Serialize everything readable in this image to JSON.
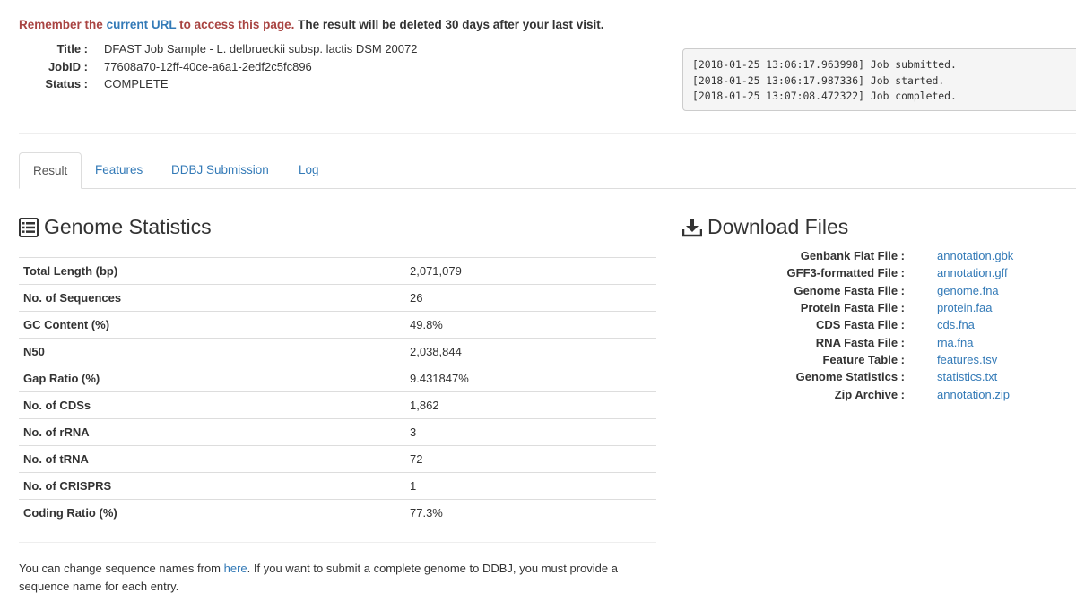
{
  "notice": {
    "prefix": "Remember the",
    "link": "current URL",
    "mid": "to access this page.",
    "rest": "The result will be deleted 30 days after your last visit."
  },
  "job": {
    "title_label": "Title :",
    "title": "DFAST Job Sample - L. delbrueckii subsp. lactis DSM 20072",
    "jobid_label": "JobID :",
    "jobid": "77608a70-12ff-40ce-a6a1-2edf2c5fc896",
    "status_label": "Status :",
    "status": "COMPLETE"
  },
  "log": [
    "[2018-01-25 13:06:17.963998] Job submitted.",
    "[2018-01-25 13:06:17.987336] Job started.",
    "[2018-01-25 13:07:08.472322] Job completed."
  ],
  "tabs": [
    "Result",
    "Features",
    "DDBJ Submission",
    "Log"
  ],
  "stats": {
    "heading": "Genome Statistics",
    "rows": [
      {
        "key": "Total Length (bp)",
        "value": "2,071,079"
      },
      {
        "key": "No. of Sequences",
        "value": "26"
      },
      {
        "key": "GC Content (%)",
        "value": "49.8%"
      },
      {
        "key": "N50",
        "value": "2,038,844"
      },
      {
        "key": "Gap Ratio (%)",
        "value": "9.431847%"
      },
      {
        "key": "No. of CDSs",
        "value": "1,862"
      },
      {
        "key": "No. of rRNA",
        "value": "3"
      },
      {
        "key": "No. of tRNA",
        "value": "72"
      },
      {
        "key": "No. of CRISPRS",
        "value": "1"
      },
      {
        "key": "Coding Ratio (%)",
        "value": "77.3%"
      }
    ]
  },
  "note": {
    "before": "You can change sequence names from",
    "link": "here",
    "after": ". If you want to submit a complete genome to DDBJ, you must provide a sequence name for each entry."
  },
  "downloads": {
    "heading": "Download Files",
    "files": [
      {
        "label": "Genbank Flat File :",
        "file": "annotation.gbk"
      },
      {
        "label": "GFF3-formatted File :",
        "file": "annotation.gff"
      },
      {
        "label": "Genome Fasta File :",
        "file": "genome.fna"
      },
      {
        "label": "Protein Fasta File :",
        "file": "protein.faa"
      },
      {
        "label": "CDS Fasta File :",
        "file": "cds.fna"
      },
      {
        "label": "RNA Fasta File :",
        "file": "rna.fna"
      },
      {
        "label": "Feature Table :",
        "file": "features.tsv"
      },
      {
        "label": "Genome Statistics :",
        "file": "statistics.txt"
      },
      {
        "label": "Zip Archive :",
        "file": "annotation.zip"
      }
    ]
  },
  "colors": {
    "link": "#337ab7",
    "warning": "#a94442",
    "text": "#333333"
  },
  "icons": {
    "stats": "list-alt-icon",
    "download": "download-icon"
  }
}
